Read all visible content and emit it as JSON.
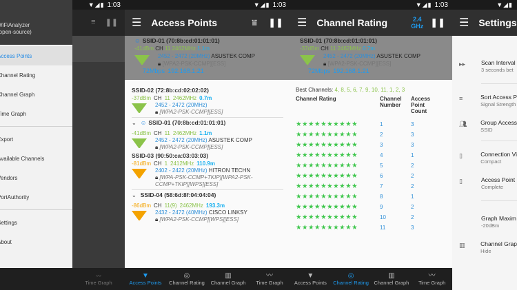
{
  "status": {
    "time": "1:03",
    "icons": "▼◢▮"
  },
  "drawer": {
    "header_line1": "WiFiAnalyzer",
    "header_line2": "(open-source)",
    "items": [
      {
        "label": "Access Points",
        "active": true
      },
      {
        "label": "Channel Rating",
        "active": false
      },
      {
        "label": "Channel Graph",
        "active": false
      },
      {
        "label": "Time Graph",
        "active": false
      },
      {
        "label": "Export",
        "active": false
      },
      {
        "label": "Available Channels",
        "active": false
      },
      {
        "label": "Vendors",
        "active": false
      },
      {
        "label": "PortAuthority",
        "active": false
      },
      {
        "label": "Settings",
        "active": false
      },
      {
        "label": "About",
        "active": false
      }
    ],
    "bottom_label": "Time Graph"
  },
  "ap_screen": {
    "title": "Access Points",
    "connected": {
      "ssid": "SSID-01 (70:8b:cd:01:01:01)",
      "dbm": "-41dBm",
      "ch_label": "CH",
      "ch": "11",
      "freq": "2462MHz",
      "dist": "1.1m",
      "range": "2452 - 2472 (20MHz)",
      "vendor": "ASUSTEK COMP",
      "security": "[WPA2-PSK-CCMP][ESS]",
      "speed": "72Mbps",
      "ip": "192.168.1.21"
    },
    "list": [
      {
        "title": "SSID-02 (72:8b:cd:02:02:02)",
        "dbm": "-37dBm",
        "ch_label": "CH",
        "ch": "11",
        "freq": "2462MHz",
        "dist": "0.7m",
        "range": "2452 - 2472 (20MHz)",
        "vendor": "",
        "security": "[WPA2-PSK-CCMP][ESS]",
        "strength": "green"
      },
      {
        "title": "SSID-01 (70:8b:cd:01:01:01)",
        "dbm": "-41dBm",
        "ch_label": "CH",
        "ch": "11",
        "freq": "2462MHz",
        "dist": "1.1m",
        "range": "2452 - 2472 (20MHz)",
        "vendor": "ASUSTEK COMP",
        "security": "[WPA2-PSK-CCMP][ESS]",
        "strength": "green"
      },
      {
        "title": "SSID-03 (90:50:ca:03:03:03)",
        "dbm": "-81dBm",
        "ch_label": "CH",
        "ch": "1",
        "freq": "2412MHz",
        "dist": "110.9m",
        "range": "2402 - 2422 (20MHz)",
        "vendor": "HITRON TECHN",
        "security": "[WPA-PSK-CCMP+TKIP][WPA2-PSK-",
        "security2": "CCMP+TKIP][WPS][ESS]",
        "strength": "orange"
      },
      {
        "title": "SSID-04 (58:6d:8f:04:04:04)",
        "dbm": "-86dBm",
        "ch_label": "CH",
        "ch": "11(9)",
        "freq": "2462MHz",
        "dist": "193.3m",
        "range": "2432 - 2472 (40MHz)",
        "vendor": "CISCO LINKSY",
        "security": "[WPA2-PSK-CCMP][WPS][ESS]",
        "strength": "orange"
      }
    ]
  },
  "rating_screen": {
    "title": "Channel Rating",
    "band_line1": "2.4",
    "band_line2": "GHz",
    "connected": {
      "ssid": "SSID-01 (70:8b:cd:01:01:01)",
      "dbm": "-37dBm",
      "ch_label": "CH",
      "ch": "11",
      "freq": "2462MHz",
      "dist": "0.7m",
      "range": "2452 - 2472 (20MHz)",
      "vendor": "ASUSTEK COMP",
      "security": "[WPA2-PSK-CCMP][ESS]",
      "speed": "72Mbps",
      "ip": "192.168.1.21"
    },
    "best_label": "Best Channels:",
    "best_channels": "4, 8, 5, 6, 7, 9, 10, 11, 1, 2, 3",
    "col_rating": "Channel Rating",
    "col_number_1": "Channel",
    "col_number_2": "Number",
    "col_count_1": "Access",
    "col_count_2": "Point",
    "col_count_3": "Count",
    "rows": [
      {
        "channel": "1",
        "count": "3",
        "stars": 10
      },
      {
        "channel": "2",
        "count": "3",
        "stars": 10
      },
      {
        "channel": "3",
        "count": "3",
        "stars": 10
      },
      {
        "channel": "4",
        "count": "1",
        "stars": 10
      },
      {
        "channel": "5",
        "count": "2",
        "stars": 10
      },
      {
        "channel": "6",
        "count": "2",
        "stars": 10
      },
      {
        "channel": "7",
        "count": "2",
        "stars": 10
      },
      {
        "channel": "8",
        "count": "1",
        "stars": 10
      },
      {
        "channel": "9",
        "count": "2",
        "stars": 10
      },
      {
        "channel": "10",
        "count": "2",
        "stars": 10
      },
      {
        "channel": "11",
        "count": "3",
        "stars": 10
      }
    ]
  },
  "settings_screen": {
    "title": "Settings",
    "items": [
      {
        "title": "Scan Interval",
        "summary": "3 seconds bet",
        "icon": "fast-forward-icon"
      },
      {
        "title": "Sort Access P",
        "summary": "Signal Strength",
        "icon": "sort-icon"
      },
      {
        "title": "Group Access",
        "summary": "SSID",
        "icon": "group-icon"
      },
      {
        "title": "Connection Vi",
        "summary": "Compact",
        "icon": "view-icon"
      },
      {
        "title": "Access Point",
        "summary": "Complete",
        "icon": "view-icon"
      },
      {
        "title": "Graph Maxim",
        "summary": "-20dBm",
        "icon": ""
      },
      {
        "title": "Channel Grap",
        "summary": "Hide",
        "icon": "bar-chart-icon"
      }
    ]
  },
  "bottom_nav": [
    {
      "label": "Access Points",
      "icon": "wifi-icon"
    },
    {
      "label": "Channel Rating",
      "icon": "signal-icon"
    },
    {
      "label": "Channel Graph",
      "icon": "bar-chart-icon"
    },
    {
      "label": "Time Graph",
      "icon": "line-chart-icon"
    }
  ],
  "colors": {
    "accent": "#1e9bf0",
    "good": "#8bc34a",
    "weak": "#f4a300",
    "star": "#3ec64c"
  }
}
